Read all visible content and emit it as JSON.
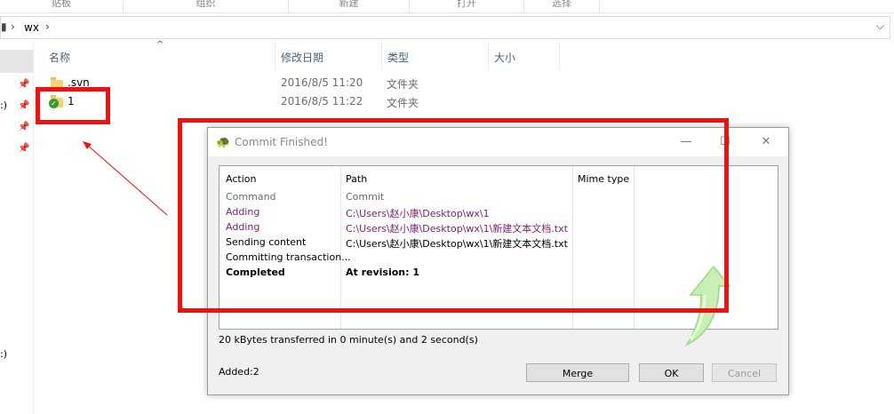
{
  "ribbon": {
    "groups": [
      "贴板",
      "组织",
      "新建",
      "打开",
      "选择"
    ]
  },
  "address": {
    "path_segment": "wx"
  },
  "nav": {
    "drive_fragment": ":)"
  },
  "columns": {
    "name": "名称",
    "date": "修改日期",
    "type": "类型",
    "size": "大小"
  },
  "files": [
    {
      "name": ".svn",
      "date": "2016/8/5 11:20",
      "type": "文件夹"
    },
    {
      "name": "1",
      "date": "2016/8/5 11:22",
      "type": "文件夹"
    }
  ],
  "dialog": {
    "title": "Commit Finished!",
    "headers": {
      "action": "Action",
      "path": "Path",
      "mime": "Mime type"
    },
    "rows": [
      {
        "action": "Command",
        "path": "Commit",
        "style": "gray"
      },
      {
        "action": "Adding",
        "path": "C:\\Users\\赵小康\\Desktop\\wx\\1",
        "style": "purple"
      },
      {
        "action": "Adding",
        "path": "C:\\Users\\赵小康\\Desktop\\wx\\1\\新建文本文档.txt",
        "style": "purple"
      },
      {
        "action": "Sending content",
        "path": "C:\\Users\\赵小康\\Desktop\\wx\\1\\新建文本文档.txt",
        "style": "black"
      },
      {
        "action": "Committing transaction...",
        "path": "",
        "style": "black"
      },
      {
        "action": "Completed",
        "path": "At revision: 1",
        "style": "bold"
      }
    ],
    "transfer_text": "20 kBytes transferred in 0 minute(s) and 2 second(s)",
    "added_text": "Added:2",
    "buttons": {
      "merge": "Merge",
      "ok": "OK",
      "cancel": "Cancel"
    }
  },
  "colors": {
    "annotation_red": "#ee1111",
    "purple_text": "#7a1f72"
  }
}
